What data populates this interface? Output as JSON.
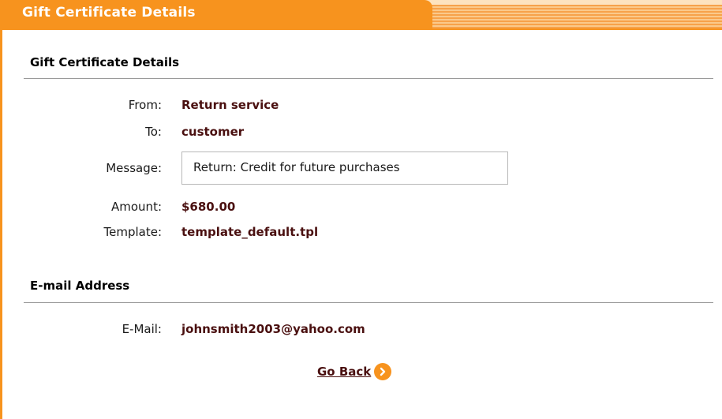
{
  "header": {
    "title": "Gift Certificate Details"
  },
  "details_section": {
    "title": "Gift Certificate Details",
    "fields": {
      "from": {
        "label": "From:",
        "value": "Return service"
      },
      "to": {
        "label": "To:",
        "value": "customer"
      },
      "message": {
        "label": "Message:",
        "value": "Return: Credit for future purchases"
      },
      "amount": {
        "label": "Amount:",
        "value": "$680.00"
      },
      "template": {
        "label": "Template:",
        "value": "template_default.tpl"
      }
    }
  },
  "email_section": {
    "title": "E-mail Address",
    "email": {
      "label": "E-Mail:",
      "value": "johnsmith2003@yahoo.com"
    }
  },
  "actions": {
    "go_back_label": "Go Back"
  },
  "colors": {
    "accent": "#f7931e",
    "value_text": "#4a1010"
  },
  "icons": {
    "go_back": "arrow-right-circle-icon"
  }
}
